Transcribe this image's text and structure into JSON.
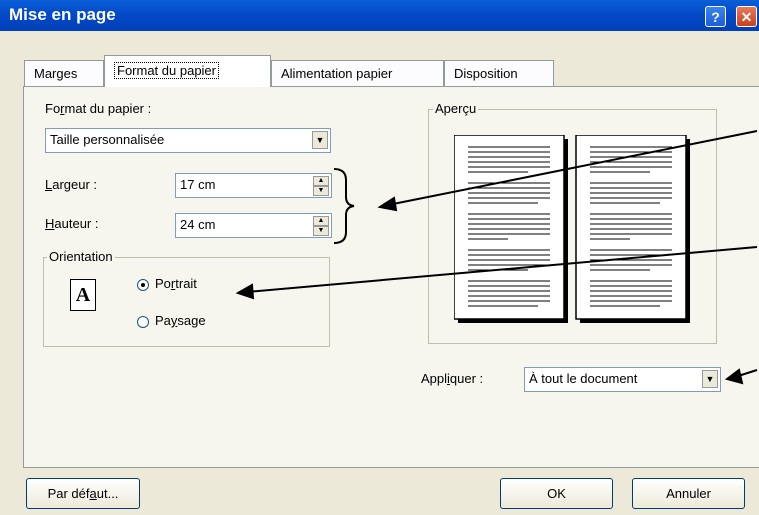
{
  "window": {
    "title": "Mise en page",
    "help_label": "?",
    "close_label": "✕"
  },
  "tabs": [
    {
      "label": "Marges"
    },
    {
      "label": "Format du papier"
    },
    {
      "label": "Alimentation papier"
    },
    {
      "label": "Disposition"
    }
  ],
  "format": {
    "label_pre": "Fo",
    "label_u": "r",
    "label_post": "mat du papier :",
    "value": "Taille personnalisée"
  },
  "largeur": {
    "label_u": "L",
    "label_post": "argeur :",
    "value": "17 cm"
  },
  "hauteur": {
    "label_u": "H",
    "label_post": "auteur :",
    "value": "24 cm"
  },
  "orientation": {
    "title": "Orientation",
    "icon_letter": "A",
    "portrait": {
      "pre": "Po",
      "u": "r",
      "post": "trait",
      "selected": true
    },
    "paysage": {
      "pre": "Pa",
      "u": "y",
      "post": "sage",
      "selected": false
    }
  },
  "apercu": {
    "title": "Aperçu"
  },
  "appliquer": {
    "pre": "Appl",
    "u": "i",
    "post": "quer :",
    "value": "À tout le document"
  },
  "buttons": {
    "default_pre": "Par déf",
    "default_u": "a",
    "default_post": "ut...",
    "ok": "OK",
    "cancel": "Annuler"
  }
}
